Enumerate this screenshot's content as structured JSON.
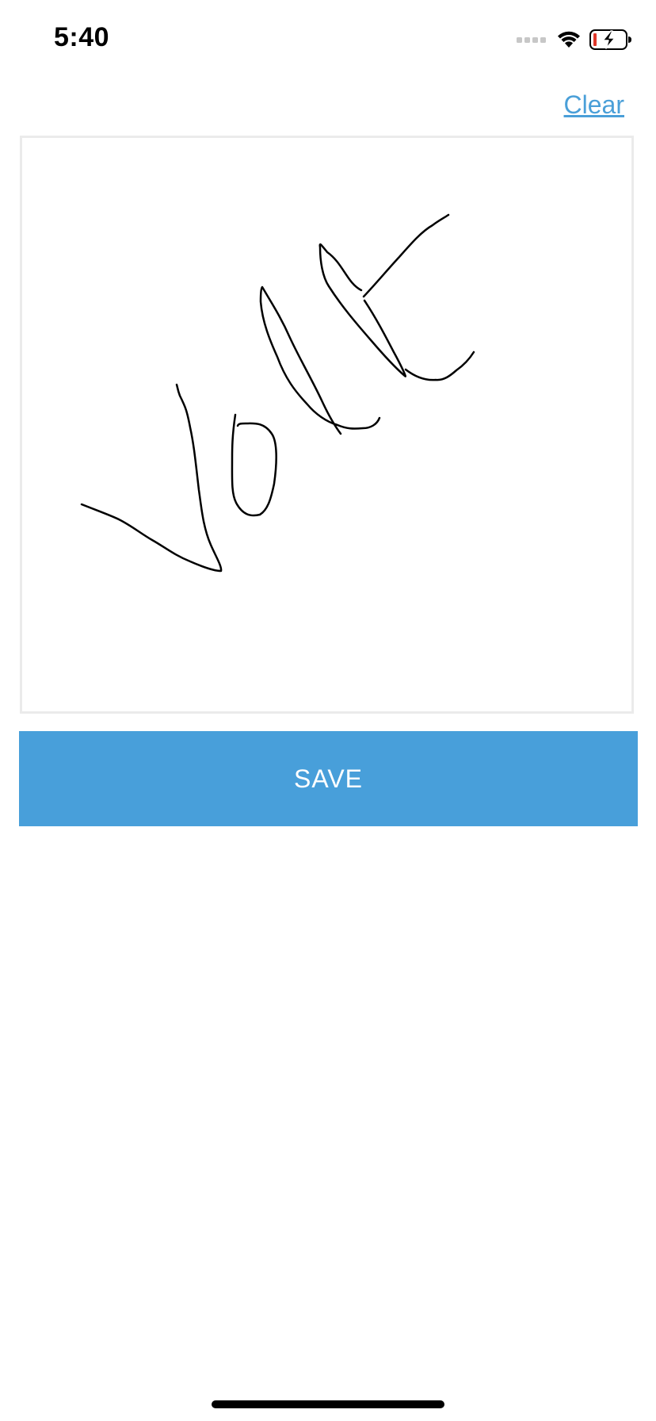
{
  "status_bar": {
    "time": "5:40",
    "icons": [
      "cellular-signal-icon",
      "wifi-icon",
      "battery-charging-icon"
    ],
    "battery_low_color": "#e0372a"
  },
  "header": {
    "clear_label": "Clear"
  },
  "signature_pad": {
    "stroke_color": "#000000",
    "border_color": "#ebebeb"
  },
  "actions": {
    "save_label": "SAVE",
    "save_color": "#489fda"
  }
}
